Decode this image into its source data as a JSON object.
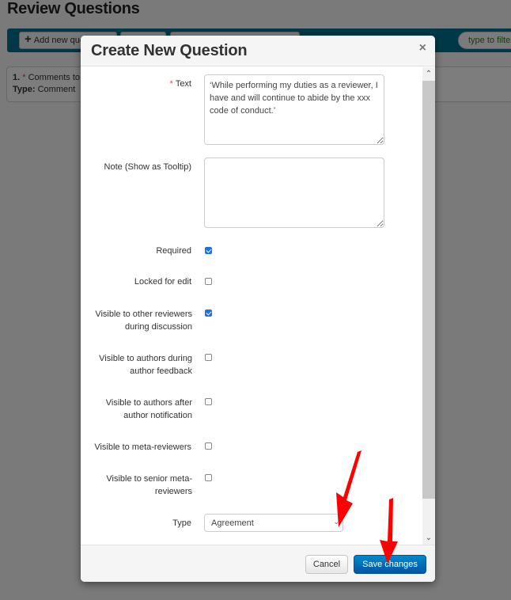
{
  "page": {
    "title": "Review Questions",
    "toolbar": {
      "add_button_label": "Add new question",
      "filter_placeholder": "type to filter"
    },
    "question_card": {
      "number": "1.",
      "required_mark": "*",
      "text": "Comments to authors",
      "type_label": "Type:",
      "type_value": "Comment"
    }
  },
  "modal": {
    "title": "Create New Question",
    "close_glyph": "×",
    "fields": {
      "text": {
        "required_mark": "*",
        "label": "Text",
        "value": "‘While performing my duties as a reviewer, I have and will continue to abide by the xxx code of conduct.’"
      },
      "note": {
        "label": "Note (Show as Tooltip)",
        "value": ""
      },
      "checkboxes": [
        {
          "label": "Required",
          "checked": true
        },
        {
          "label": "Locked for edit",
          "checked": false
        },
        {
          "label": "Visible to other reviewers during discussion",
          "checked": true
        },
        {
          "label": "Visible to authors during author feedback",
          "checked": false
        },
        {
          "label": "Visible to authors after author notification",
          "checked": false
        },
        {
          "label": "Visible to meta-reviewers",
          "checked": false
        },
        {
          "label": "Visible to senior meta-reviewers",
          "checked": false
        }
      ],
      "type": {
        "label": "Type",
        "selected": "Agreement"
      }
    },
    "footer": {
      "cancel_label": "Cancel",
      "save_label": "Save changes"
    }
  },
  "annotations": {
    "arrow_color": "#ff0000"
  }
}
